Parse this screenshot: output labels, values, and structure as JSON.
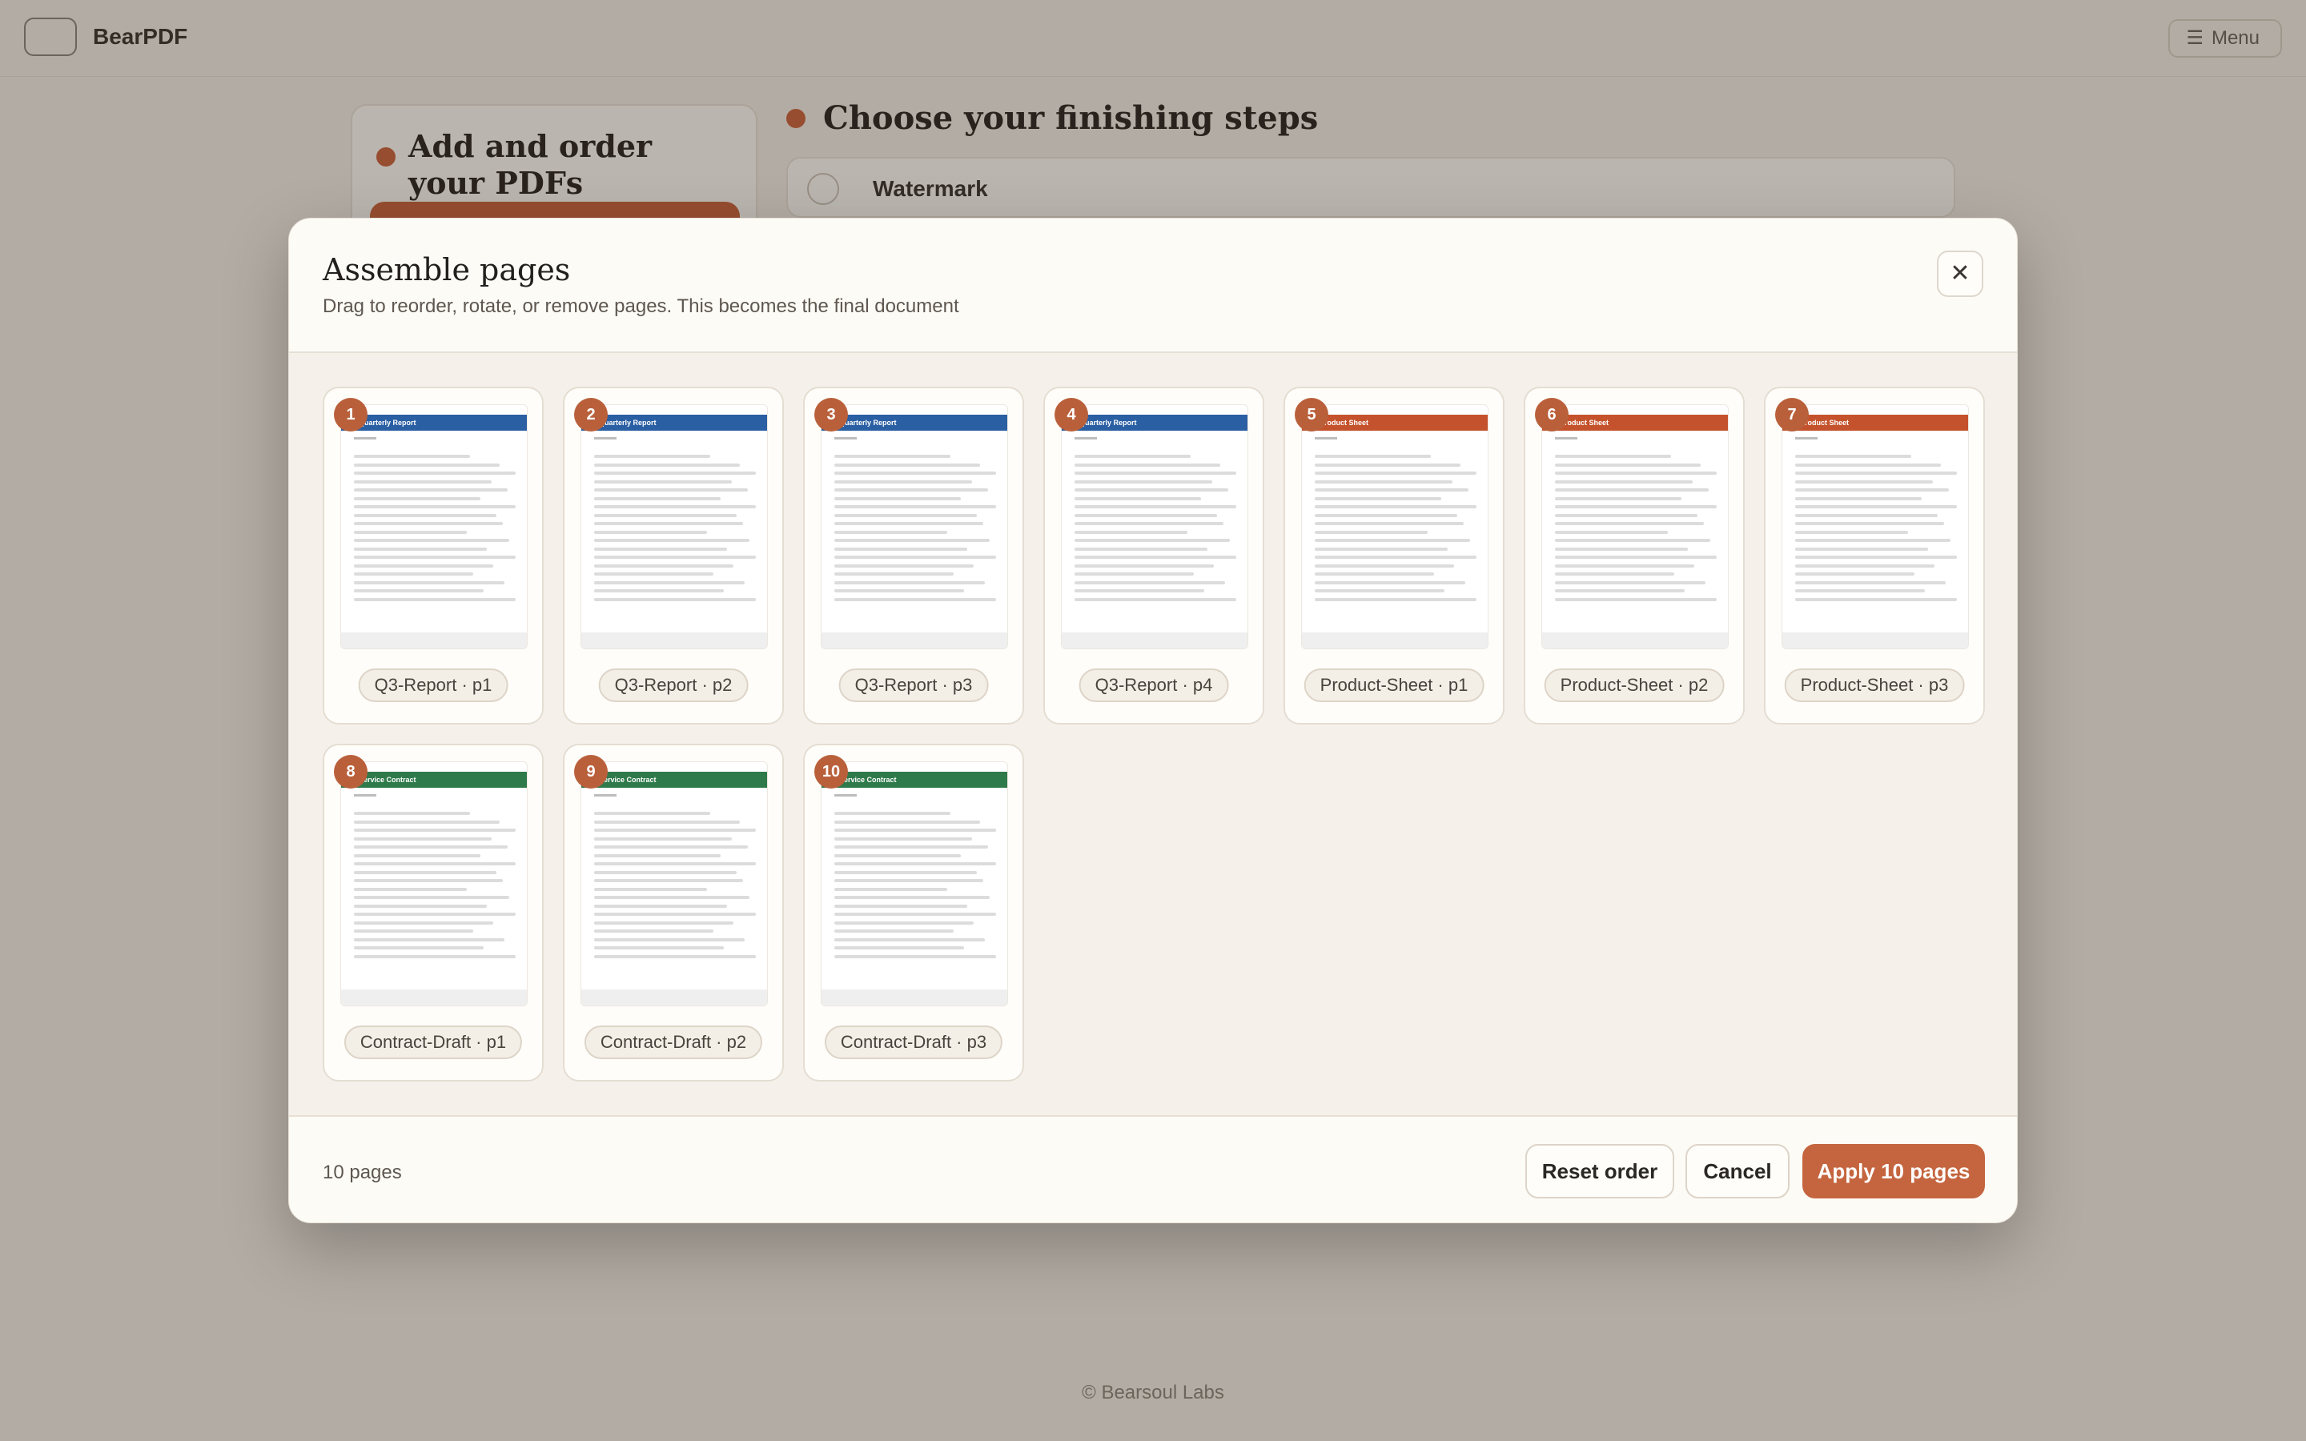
{
  "app": {
    "name": "BearPDF",
    "menu_label": "Menu",
    "menu_icon": "menu-icon",
    "left_panel_title": "Add and order your PDFs",
    "right_panel_title": "Choose your finishing steps",
    "watermark_label": "Watermark",
    "footer": "© Bearsoul Labs"
  },
  "modal": {
    "title": "Assemble pages",
    "subtitle": "Drag to reorder, rotate, or remove pages. This becomes the final document",
    "close_glyph": "✕",
    "pages": [
      {
        "num": "1",
        "label": "Q3-Report · p1",
        "doc_title": "Quarterly Report",
        "meta": "Page 1 of 4",
        "color": "#2b5fa3"
      },
      {
        "num": "2",
        "label": "Q3-Report · p2",
        "doc_title": "Quarterly Report",
        "meta": "Page 2 of 4",
        "color": "#2b5fa3"
      },
      {
        "num": "3",
        "label": "Q3-Report · p3",
        "doc_title": "Quarterly Report",
        "meta": "Page 3 of 4",
        "color": "#2b5fa3"
      },
      {
        "num": "4",
        "label": "Q3-Report · p4",
        "doc_title": "Quarterly Report",
        "meta": "Page 4 of 4",
        "color": "#2b5fa3"
      },
      {
        "num": "5",
        "label": "Product-Sheet · p1",
        "doc_title": "Product Sheet",
        "meta": "Page 1 of 3",
        "color": "#c4532d"
      },
      {
        "num": "6",
        "label": "Product-Sheet · p2",
        "doc_title": "Product Sheet",
        "meta": "Page 2 of 3",
        "color": "#c4532d"
      },
      {
        "num": "7",
        "label": "Product-Sheet · p3",
        "doc_title": "Product Sheet",
        "meta": "Page 3 of 3",
        "color": "#c4532d"
      },
      {
        "num": "8",
        "label": "Contract-Draft · p1",
        "doc_title": "Service Contract",
        "meta": "Page 1 of 3",
        "color": "#2f7a4a"
      },
      {
        "num": "9",
        "label": "Contract-Draft · p2",
        "doc_title": "Service Contract",
        "meta": "Page 2 of 3",
        "color": "#2f7a4a"
      },
      {
        "num": "10",
        "label": "Contract-Draft · p3",
        "doc_title": "Service Contract",
        "meta": "Page 3 of 3",
        "color": "#2f7a4a"
      }
    ],
    "page_count": "10 pages",
    "buttons": {
      "reset": "Reset order",
      "cancel": "Cancel",
      "apply": "Apply 10 pages"
    }
  }
}
